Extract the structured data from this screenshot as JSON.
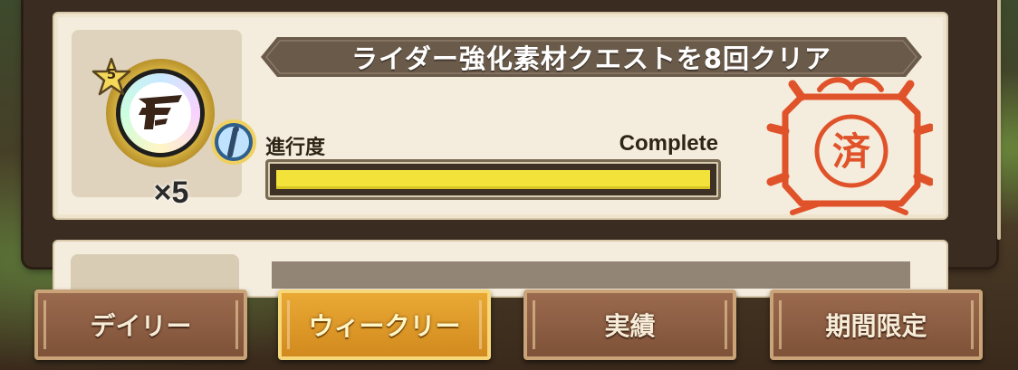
{
  "mission": {
    "title": "ライダー強化素材クエストを8回クリア",
    "progress_label": "進行度",
    "progress_status": "Complete",
    "progress_fraction": 1.0,
    "reward_rarity": "5",
    "reward_quantity": "×5",
    "stamp_text": "済",
    "reward_icon": "rarity-orb-icon",
    "info_icon": "info-icon"
  },
  "tabs": [
    {
      "label": "デイリー",
      "active": false
    },
    {
      "label": "ウィークリー",
      "active": true
    },
    {
      "label": "実績",
      "active": false
    },
    {
      "label": "期間限定",
      "active": false
    }
  ],
  "colors": {
    "card_bg": "#f4ecdc",
    "title_banner": "#6a5a4a",
    "progress_fill": "#f3e23a",
    "stamp": "#e0532a",
    "tab_active": "#e0a030",
    "tab_inactive": "#8a5c42"
  }
}
